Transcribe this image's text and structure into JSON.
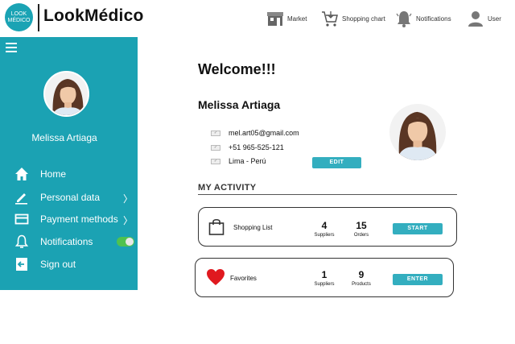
{
  "header": {
    "logo_line1": "LOOK",
    "logo_line2": "MÉDICO",
    "app_name": "LookMédico",
    "nav": [
      {
        "label": "Market",
        "icon": "market-icon"
      },
      {
        "label": "Shopping chart",
        "icon": "cart-icon"
      },
      {
        "label": "Notifications",
        "icon": "bell-icon"
      },
      {
        "label": "User",
        "icon": "user-icon"
      }
    ]
  },
  "sidebar": {
    "user_name": "Melissa Artiaga",
    "items": [
      {
        "label": "Home",
        "icon": "home-icon"
      },
      {
        "label": "Personal data",
        "icon": "pencil-icon",
        "chevron": "〉"
      },
      {
        "label": "Payment methods",
        "icon": "credit-card-icon",
        "chevron": "〉"
      },
      {
        "label": "Notifications",
        "icon": "bell-icon",
        "toggle_on": true
      },
      {
        "label": "Sign out",
        "icon": "sign-out-icon"
      }
    ]
  },
  "main": {
    "welcome": "Welcome!!!",
    "name": "Melissa Artiaga",
    "email": "mel.art05@gmail.com",
    "phone": "+51 965-525-121",
    "location": "Lima - Perú",
    "edit_label": "EDIT",
    "activity_title": "MY ACTIVITY",
    "cards": [
      {
        "label": "Shopping List",
        "icon": "shopping-bag-icon",
        "stat1_value": "4",
        "stat1_label": "Suppliers",
        "stat2_value": "15",
        "stat2_label": "Orders",
        "button": "START"
      },
      {
        "label": "Favorites",
        "icon": "heart-icon",
        "stat1_value": "1",
        "stat1_label": "Suppliers",
        "stat2_value": "9",
        "stat2_label": "Products",
        "button": "ENTER"
      }
    ]
  },
  "colors": {
    "accent": "#1ba2b3",
    "button": "#33aebf",
    "toggle_on": "#4fc24f",
    "heart": "#e0191f"
  }
}
